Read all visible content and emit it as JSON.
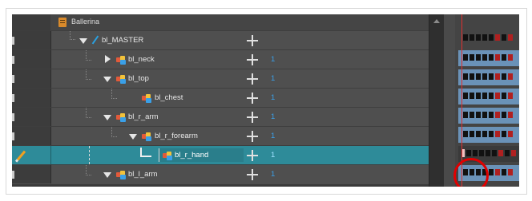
{
  "scene": {
    "title": "Ballerina"
  },
  "layers": [
    {
      "name": "bl_MASTER",
      "number": "",
      "type": "drawing",
      "expanded": true
    },
    {
      "name": "bl_neck",
      "number": "1",
      "type": "peg",
      "expanded": false
    },
    {
      "name": "bl_top",
      "number": "1",
      "type": "peg",
      "expanded": true
    },
    {
      "name": "bl_chest",
      "number": "1",
      "type": "peg",
      "expanded": null
    },
    {
      "name": "bl_r_arm",
      "number": "1",
      "type": "peg",
      "expanded": true
    },
    {
      "name": "bl_r_forearm",
      "number": "1",
      "type": "peg",
      "expanded": true
    },
    {
      "name": "bl_r_hand",
      "number": "1",
      "type": "peg",
      "expanded": null,
      "selected": true
    },
    {
      "name": "bl_l_arm",
      "number": "1",
      "type": "peg",
      "expanded": true
    }
  ],
  "colors": {
    "selected_row": "#2e8b99",
    "layer_number": "#3aa0e8",
    "playhead": "#e03030",
    "highlight_circle": "#e00000"
  }
}
